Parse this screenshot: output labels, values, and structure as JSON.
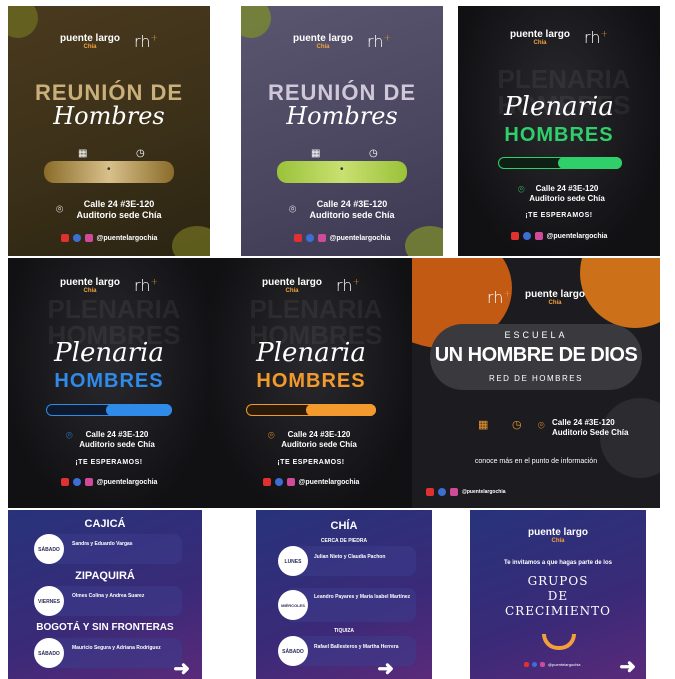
{
  "brand": {
    "puente": "puente largo",
    "chia": "Chía",
    "rh": "rh",
    "rh_sup": "+",
    "social_handle": "@puentelargochia",
    "social_handle_small": "@puentelargochia"
  },
  "tile1": {
    "title_top": "REUNIÓN DE",
    "title_script": "Hombres",
    "address_line1": "Calle 24 #3E-120",
    "address_line2": "Auditorio sede Chía",
    "bar_dot": "•"
  },
  "tile2": {
    "title_top": "REUNIÓN DE",
    "title_script": "Hombres",
    "address_line1": "Calle 24 #3E-120",
    "address_line2": "Auditorio sede Chía",
    "bar_dot": "•"
  },
  "tile3": {
    "bg_words": "PLENARIA HOMBRES",
    "title_script": "Plenaria",
    "title_block": "HOMBRES",
    "address_line1": "Calle 24 #3E-120",
    "address_line2": "Auditorio sede Chía",
    "wait": "¡TE ESPERAMOS!"
  },
  "tile4": {
    "bg_words": "PLENARIA HOMBRES",
    "title_script": "Plenaria",
    "title_block": "HOMBRES",
    "address_line1": "Calle 24 #3E-120",
    "address_line2": "Auditorio sede Chía",
    "wait": "¡TE ESPERAMOS!"
  },
  "tile5": {
    "bg_words": "PLENARIA HOMBRES",
    "title_script": "Plenaria",
    "title_block": "HOMBRES",
    "address_line1": "Calle 24 #3E-120",
    "address_line2": "Auditorio sede Chía",
    "wait": "¡TE ESPERAMOS!"
  },
  "tile6": {
    "escuela": "ESCUELA",
    "title": "UN HOMBRE DE DIOS",
    "subtitle": "RED DE HOMBRES",
    "address_line1": "Calle 24 #3E-120",
    "address_line2": "Auditorio Sede Chía",
    "info": "conoce más en el punto de información"
  },
  "tile7": {
    "sections": [
      {
        "name": "CAJICÁ",
        "day": "SÁBADO",
        "leaders": "Sandra y Eduardo Vargas"
      },
      {
        "name": "ZIPAQUIRÁ",
        "day": "VIERNES",
        "leaders": "Olmes Colina y Andrea Suarez"
      },
      {
        "name": "BOGOTÁ Y SIN FRONTERAS",
        "day": "SÁBADO",
        "leaders": "Mauricio Segura y Adriana Rodriguez"
      }
    ],
    "arrow": "➜"
  },
  "tile8": {
    "title": "CHÍA",
    "sections": [
      {
        "name": "CERCA DE PIEDRA",
        "day": "LUNES",
        "leaders": "Julian Nieto y Claudia Pachon"
      },
      {
        "name": "",
        "day": "MIÉRCOLES",
        "leaders": "Leandro Payares y María Isabel Martínez"
      },
      {
        "name": "TIQUIZA",
        "day": "SÁBADO",
        "leaders": "Rafael Ballesteros y Martha Herrera"
      }
    ],
    "arrow": "➜"
  },
  "tile9": {
    "invite": "Te invitamos a que hagas parte de los",
    "grupos_l1": "GRUPOS",
    "grupos_l2": "DE",
    "grupos_l3": "CRECIMIENTO",
    "arrow": "➜"
  }
}
